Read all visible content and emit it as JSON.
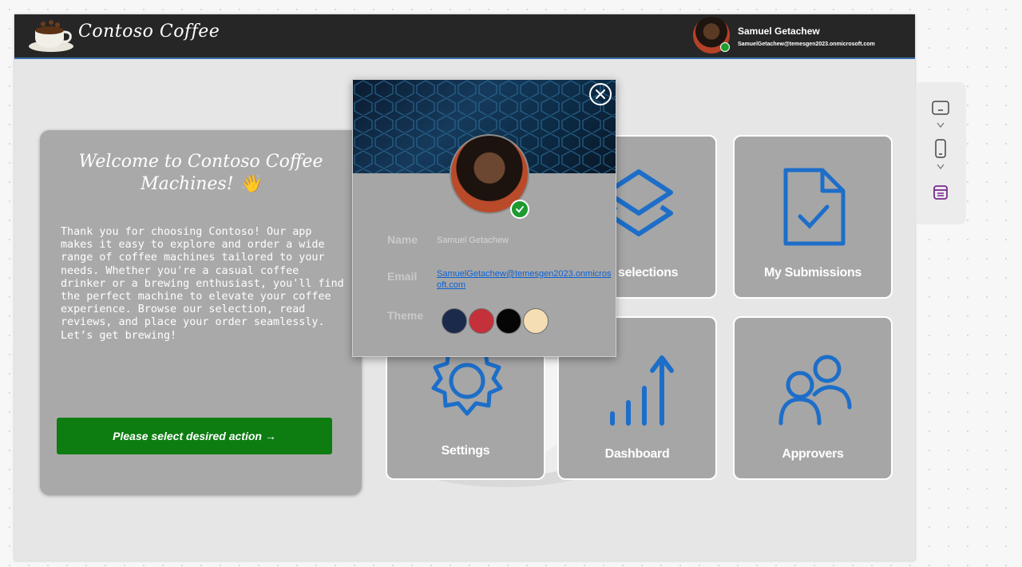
{
  "header": {
    "brand": "Contoso Coffee",
    "user_name": "Samuel Getachew",
    "user_email": "SamuelGetachew@temesgen2023.onmicrosoft.com"
  },
  "welcome": {
    "title": "Welcome to Contoso Coffee Machines! 👋",
    "body": "Thank you for choosing Contoso! Our app makes it easy to explore and order a wide range of coffee machines tailored to your needs. Whether you're a casual coffee drinker or a brewing enthusiast, you'll find the perfect machine to elevate your coffee experience. Browse our selection, read reviews, and place your order seamlessly. Let’s get brewing!",
    "button_label": "Please select desired action →"
  },
  "tiles": [
    {
      "label": "are selections",
      "icon": "layers-icon"
    },
    {
      "label": "My Submissions",
      "icon": "document-check-icon"
    },
    {
      "label": "Settings",
      "icon": "gear-icon"
    },
    {
      "label": "Dashboard",
      "icon": "bar-chart-up-icon"
    },
    {
      "label": "Approvers",
      "icon": "people-icon"
    }
  ],
  "profile": {
    "name_label": "Name",
    "name_value": "Samuel Getachew",
    "email_label": "Email",
    "email_value": "SamuelGetachew@temesgen2023.onmicrosoft.com",
    "theme_label": "Theme",
    "themes": [
      "#1b2a4a",
      "#c4313a",
      "#050505",
      "#f5deb3"
    ]
  },
  "colors": {
    "header_bg": "#262626",
    "tile_icon": "#1d6ec9",
    "button_green": "#0d7d12"
  },
  "side_panel": {
    "icons": [
      "tablet-landscape-icon",
      "chevron-down-icon",
      "phone-icon",
      "chevron-down-icon",
      "form-icon"
    ]
  }
}
